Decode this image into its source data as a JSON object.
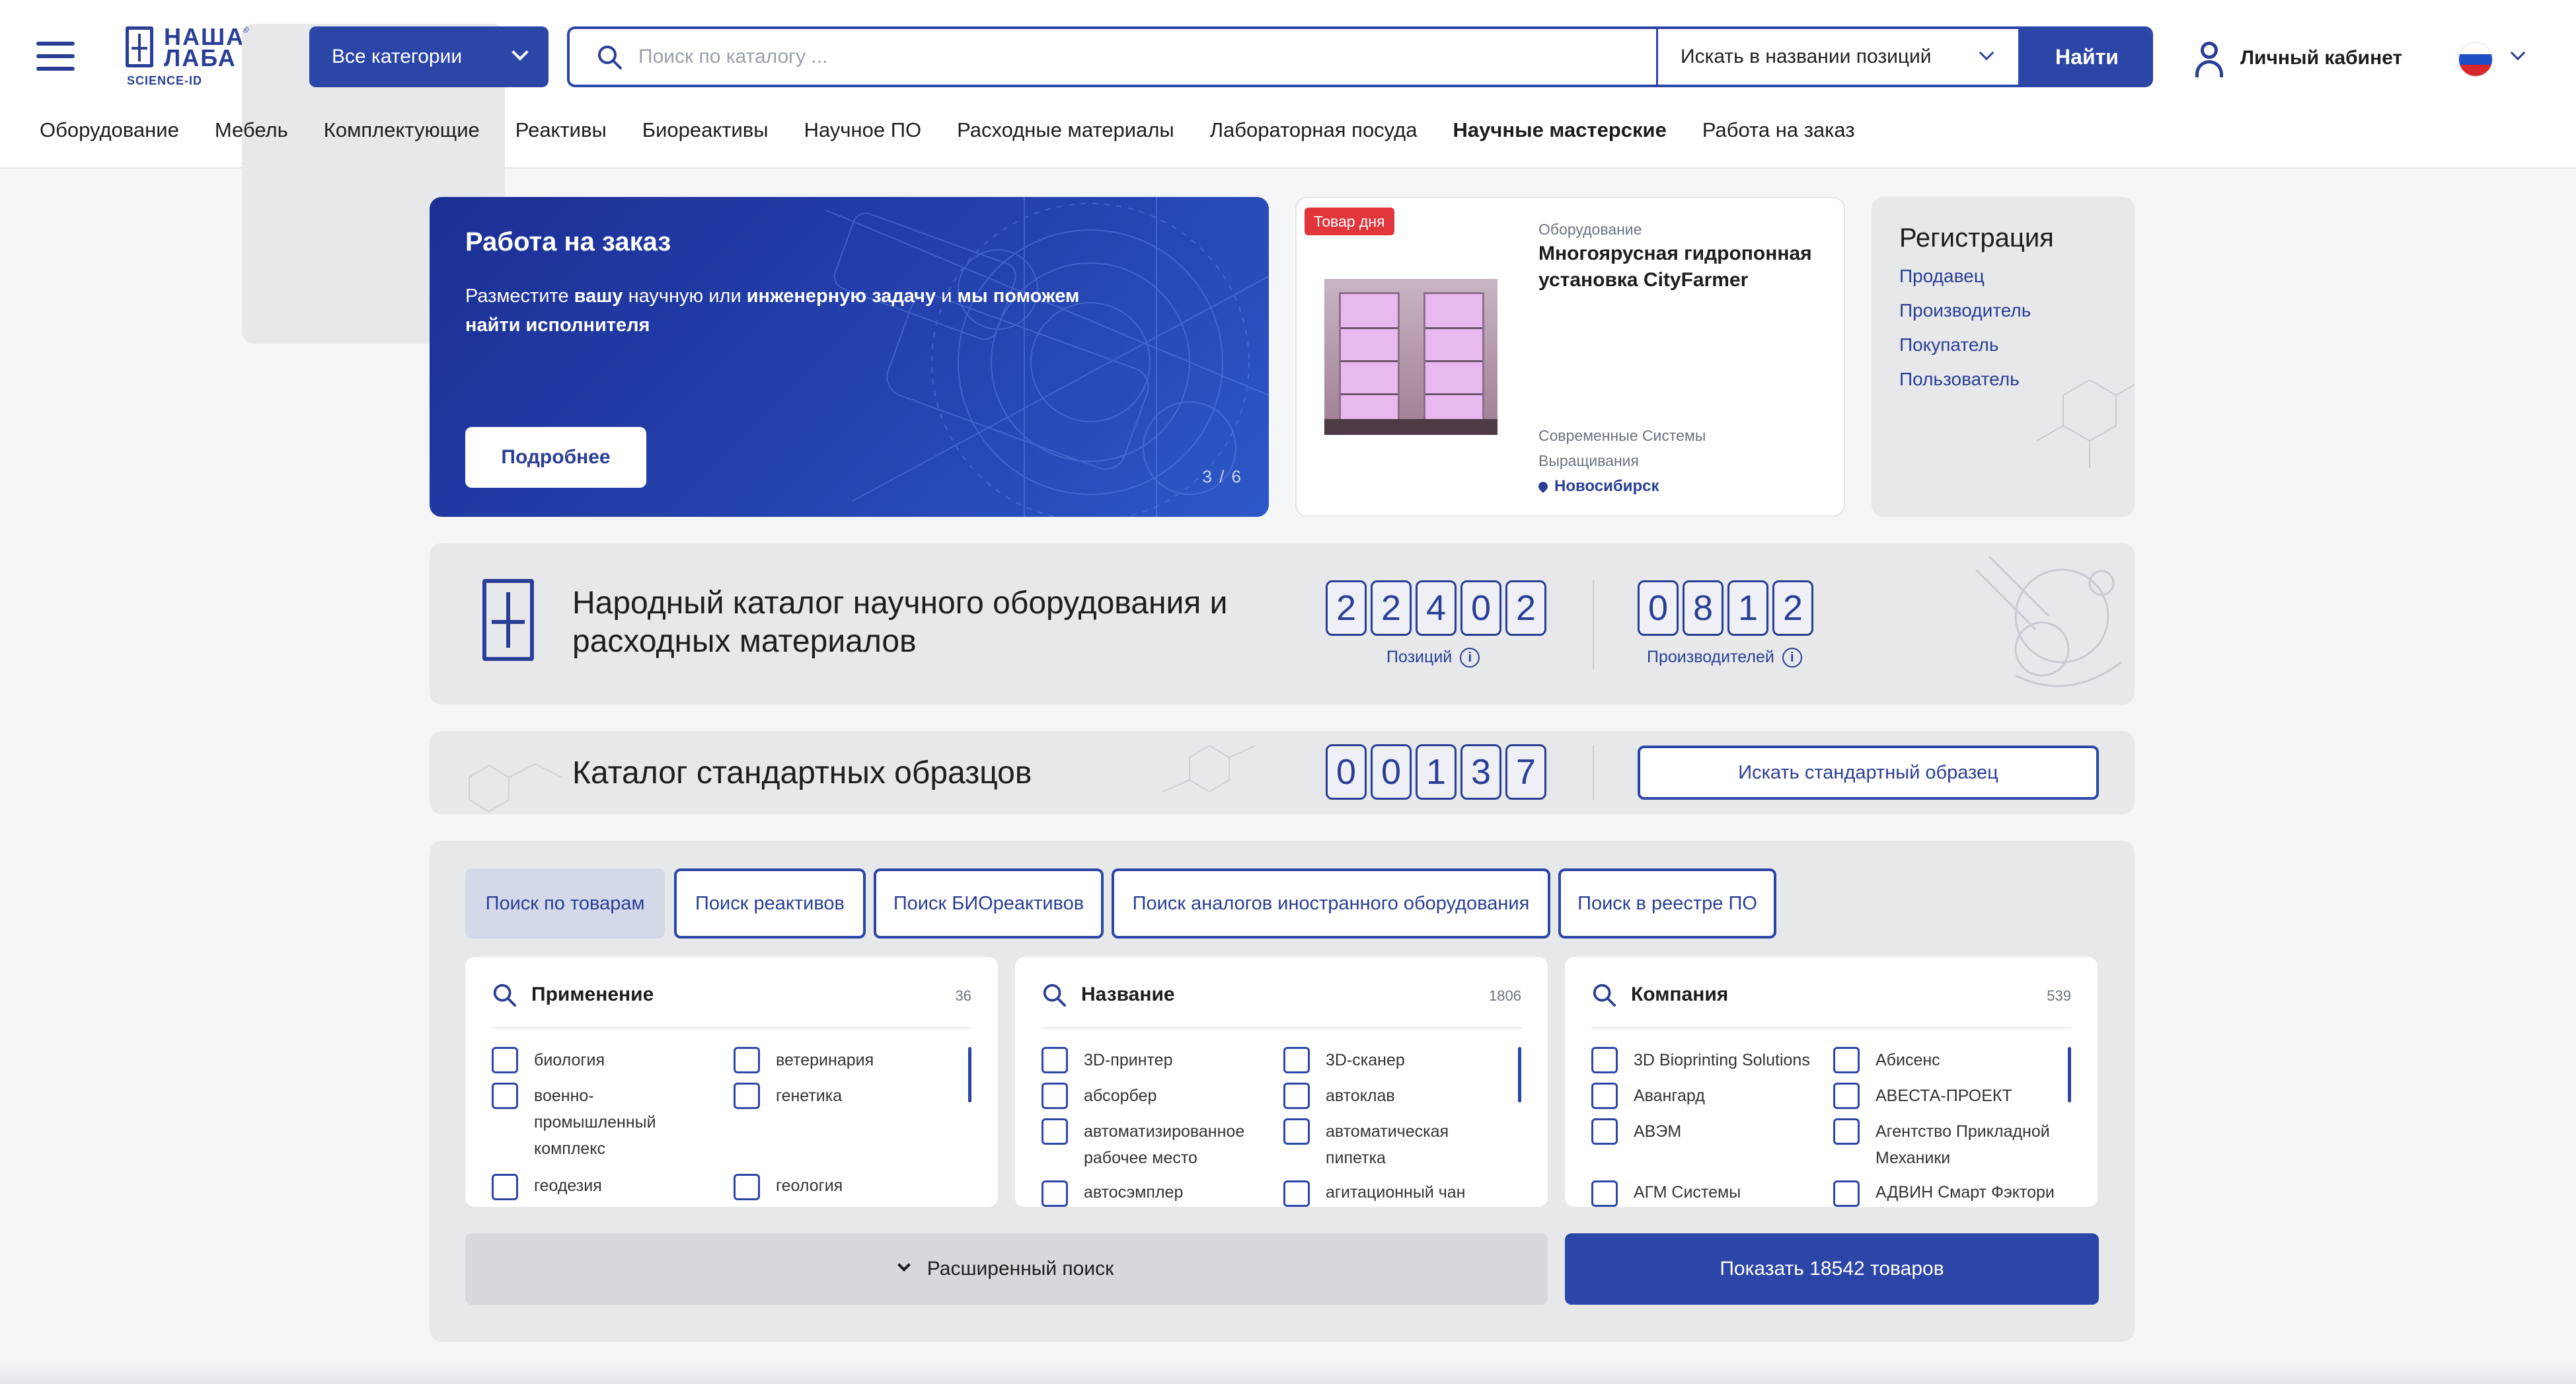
{
  "header": {
    "logo_line1": "НАША",
    "logo_line2": "ЛАБА",
    "logo_reg": "®",
    "logo_sub": "SCIENCE-ID",
    "categories_button": "Все категории",
    "search_placeholder": "Поиск по каталогу ...",
    "search_value": "",
    "search_mode": "Искать в названии позиций",
    "search_button": "Найти",
    "cabinet_label": "Личный кабинет",
    "language": "RU"
  },
  "nav": [
    {
      "label": "Оборудование"
    },
    {
      "label": "Мебель"
    },
    {
      "label": "Комплектующие"
    },
    {
      "label": "Реактивы"
    },
    {
      "label": "Биореактивы"
    },
    {
      "label": "Научное ПО"
    },
    {
      "label": "Расходные материалы"
    },
    {
      "label": "Лабораторная посуда"
    },
    {
      "label": "Научные мастерские"
    },
    {
      "label": "Работа на заказ"
    }
  ],
  "promo": {
    "title": "Работа на заказ",
    "text_1": "Разместите ",
    "text_2": "вашу",
    "text_3": " научную или ",
    "text_4": "инженерную задачу",
    "text_5": " и ",
    "text_6": "мы поможем найти исполнителя",
    "button": "Подробнее",
    "counter": "3 / 6"
  },
  "daily": {
    "badge": "Товар дня",
    "category": "Оборудование",
    "name": "Многоярусная гидропонная установка CityFarmer",
    "vendor": "Современные Системы Выращивания",
    "city": "Новосибирск"
  },
  "registration": {
    "title": "Регистрация",
    "links": [
      "Продавец",
      "Производитель",
      "Покупатель",
      "Пользователь"
    ]
  },
  "catalog": {
    "title": "Народный каталог научного оборудования и расходных материалов",
    "positions_digits": [
      "2",
      "2",
      "4",
      "0",
      "2"
    ],
    "positions_label": "Позиций",
    "manufacturers_digits": [
      "0",
      "8",
      "1",
      "2"
    ],
    "manufacturers_label": "Производителей",
    "info_icon": "i"
  },
  "standards": {
    "title": "Каталог стандартных образцов",
    "digits": [
      "0",
      "0",
      "1",
      "3",
      "7"
    ],
    "button": "Искать стандартный образец"
  },
  "search_panel": {
    "tabs": [
      {
        "label": "Поиск по товарам",
        "active": true
      },
      {
        "label": "Поиск реактивов",
        "active": false
      },
      {
        "label": "Поиск БИОреактивов",
        "active": false
      },
      {
        "label": "Поиск аналогов иностранного оборудования",
        "active": false
      },
      {
        "label": "Поиск в реестре ПО",
        "active": false
      }
    ],
    "filters": [
      {
        "title": "Применение",
        "count": "36",
        "left": [
          "биология",
          "военно-промышленный комплекс",
          "геодезия"
        ],
        "right": [
          "ветеринария",
          "генетика",
          "геология"
        ]
      },
      {
        "title": "Название",
        "count": "1806",
        "left": [
          "3D-принтер",
          "абсорбер",
          "автоматизированное рабочее место",
          "автосэмплер"
        ],
        "right": [
          "3D-сканер",
          "автоклав",
          "автоматическая пипетка",
          "агитационный чан"
        ]
      },
      {
        "title": "Компания",
        "count": "539",
        "left": [
          "3D Bioprinting Solutions",
          "Авангард",
          "АВЭМ",
          "АГМ Системы"
        ],
        "right": [
          "Абисенс",
          "АВЕСТА-ПРОЕКТ",
          "Агентство Прикладной Механики",
          "АДВИН Смарт Фэктори"
        ]
      }
    ],
    "advanced_button": "Расширенный поиск",
    "show_button": "Показать 18542 товаров"
  },
  "colors": {
    "brand": "#2c46a8",
    "brand_dark": "#2a3e95",
    "badge_red": "#e0363c",
    "panel_gray": "#e7e8ea"
  },
  "icons": [
    "menu-icon",
    "search-icon",
    "chevron-down-icon",
    "user-icon",
    "flag-ru-icon",
    "location-pin-icon",
    "info-icon",
    "checkbox-icon"
  ]
}
